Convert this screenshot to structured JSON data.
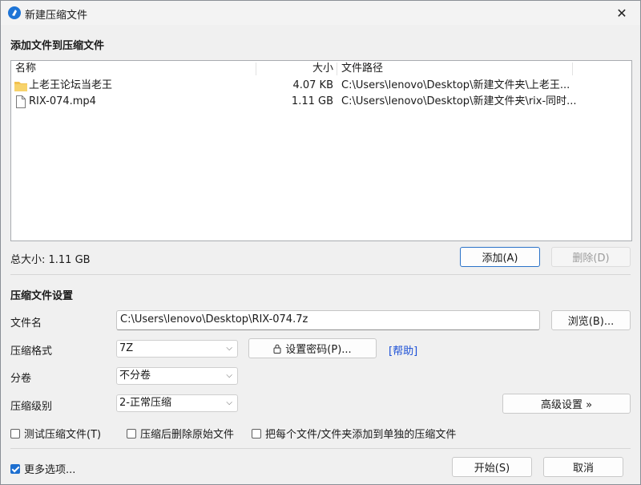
{
  "window": {
    "title": "新建压缩文件",
    "close_glyph": "✕"
  },
  "add_section": {
    "title": "添加文件到压缩文件"
  },
  "file_list": {
    "columns": [
      "名称",
      "大小",
      "文件路径"
    ],
    "rows": [
      {
        "icon": "folder-icon",
        "name": "上老王论坛当老王",
        "size": "4.07 KB",
        "path": "C:\\Users\\lenovo\\Desktop\\新建文件夹\\上老王..."
      },
      {
        "icon": "file-icon",
        "name": "RIX-074.mp4",
        "size": "1.11 GB",
        "path": "C:\\Users\\lenovo\\Desktop\\新建文件夹\\rix-同时..."
      }
    ]
  },
  "total_size": "总大小: 1.11 GB",
  "buttons": {
    "add": "添加(A)",
    "delete": "删除(D)",
    "browse": "浏览(B)...",
    "set_password": "设置密码(P)...",
    "advanced": "高级设置 »",
    "start": "开始(S)",
    "cancel": "取消"
  },
  "settings": {
    "title": "压缩文件设置",
    "filename_label": "文件名",
    "filename_value": "C:\\Users\\lenovo\\Desktop\\RIX-074.7z",
    "format_label": "压缩格式",
    "format_value": "7Z",
    "split_label": "分卷",
    "split_value": "不分卷",
    "level_label": "压缩级别",
    "level_value": "2-正常压缩",
    "help_link": "[帮助]"
  },
  "options": {
    "test_archive": {
      "label": "测试压缩文件(T)",
      "checked": false
    },
    "delete_after": {
      "label": "压缩后删除原始文件",
      "checked": false
    },
    "each_separate": {
      "label": "把每个文件/文件夹添加到单独的压缩文件",
      "checked": false
    },
    "more_options": {
      "label": "更多选项...",
      "checked": true
    }
  },
  "colors": {
    "accent": "#1d6fd0",
    "link": "#1b4fd6",
    "folder": "#f2c14e"
  }
}
